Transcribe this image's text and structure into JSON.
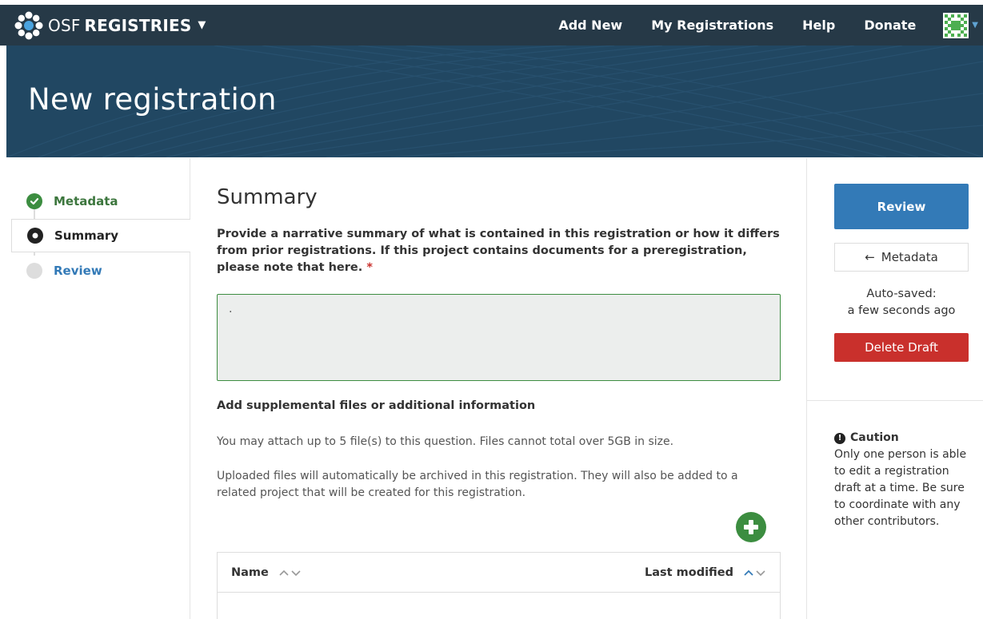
{
  "navbar": {
    "brand_osf": "OSF",
    "brand_registries": "REGISTRIES",
    "links": [
      "Add New",
      "My Registrations",
      "Help",
      "Donate"
    ],
    "colors": {
      "bar": "#263947",
      "text": "#ffffff"
    }
  },
  "banner": {
    "title": "New registration",
    "color": "#214762"
  },
  "steps": {
    "metadata": "Metadata",
    "summary": "Summary",
    "review": "Review"
  },
  "main": {
    "heading": "Summary",
    "question": "Provide a narrative summary of what is contained in this registration or how it differs from prior registrations. If this project contains documents for a preregistration, please note that here.",
    "required_mark": "*",
    "answer_value": ".",
    "supplemental_title": "Add supplemental files or additional information",
    "supplemental_p1": "You may attach up to 5 file(s) to this question. Files cannot total over 5GB in size.",
    "supplemental_p2": "Uploaded files will automatically be archived in this registration. They will also be added to a related project that will be created for this registration.",
    "files_table": {
      "col_name": "Name",
      "col_modified": "Last modified"
    }
  },
  "sidebar_right": {
    "review_label": "Review",
    "back_label": "Metadata",
    "autosave_line1": "Auto-saved:",
    "autosave_line2": "a few seconds ago",
    "delete_label": "Delete Draft",
    "caution_title": "Caution",
    "caution_text": "Only one person is able to edit a registration draft at a time. Be sure to coordinate with any other contributors.",
    "colors": {
      "review": "#337ab7",
      "delete": "#c9302c",
      "success": "#3c8d40"
    }
  },
  "icons": {
    "brand": "osf-logo-icon",
    "avatar": "user-avatar-icon",
    "check": "check-circle-icon",
    "add": "plus-circle-icon",
    "caution": "exclamation-circle-icon",
    "back": "arrow-left-icon",
    "sort": "sort-chevrons-icon"
  }
}
